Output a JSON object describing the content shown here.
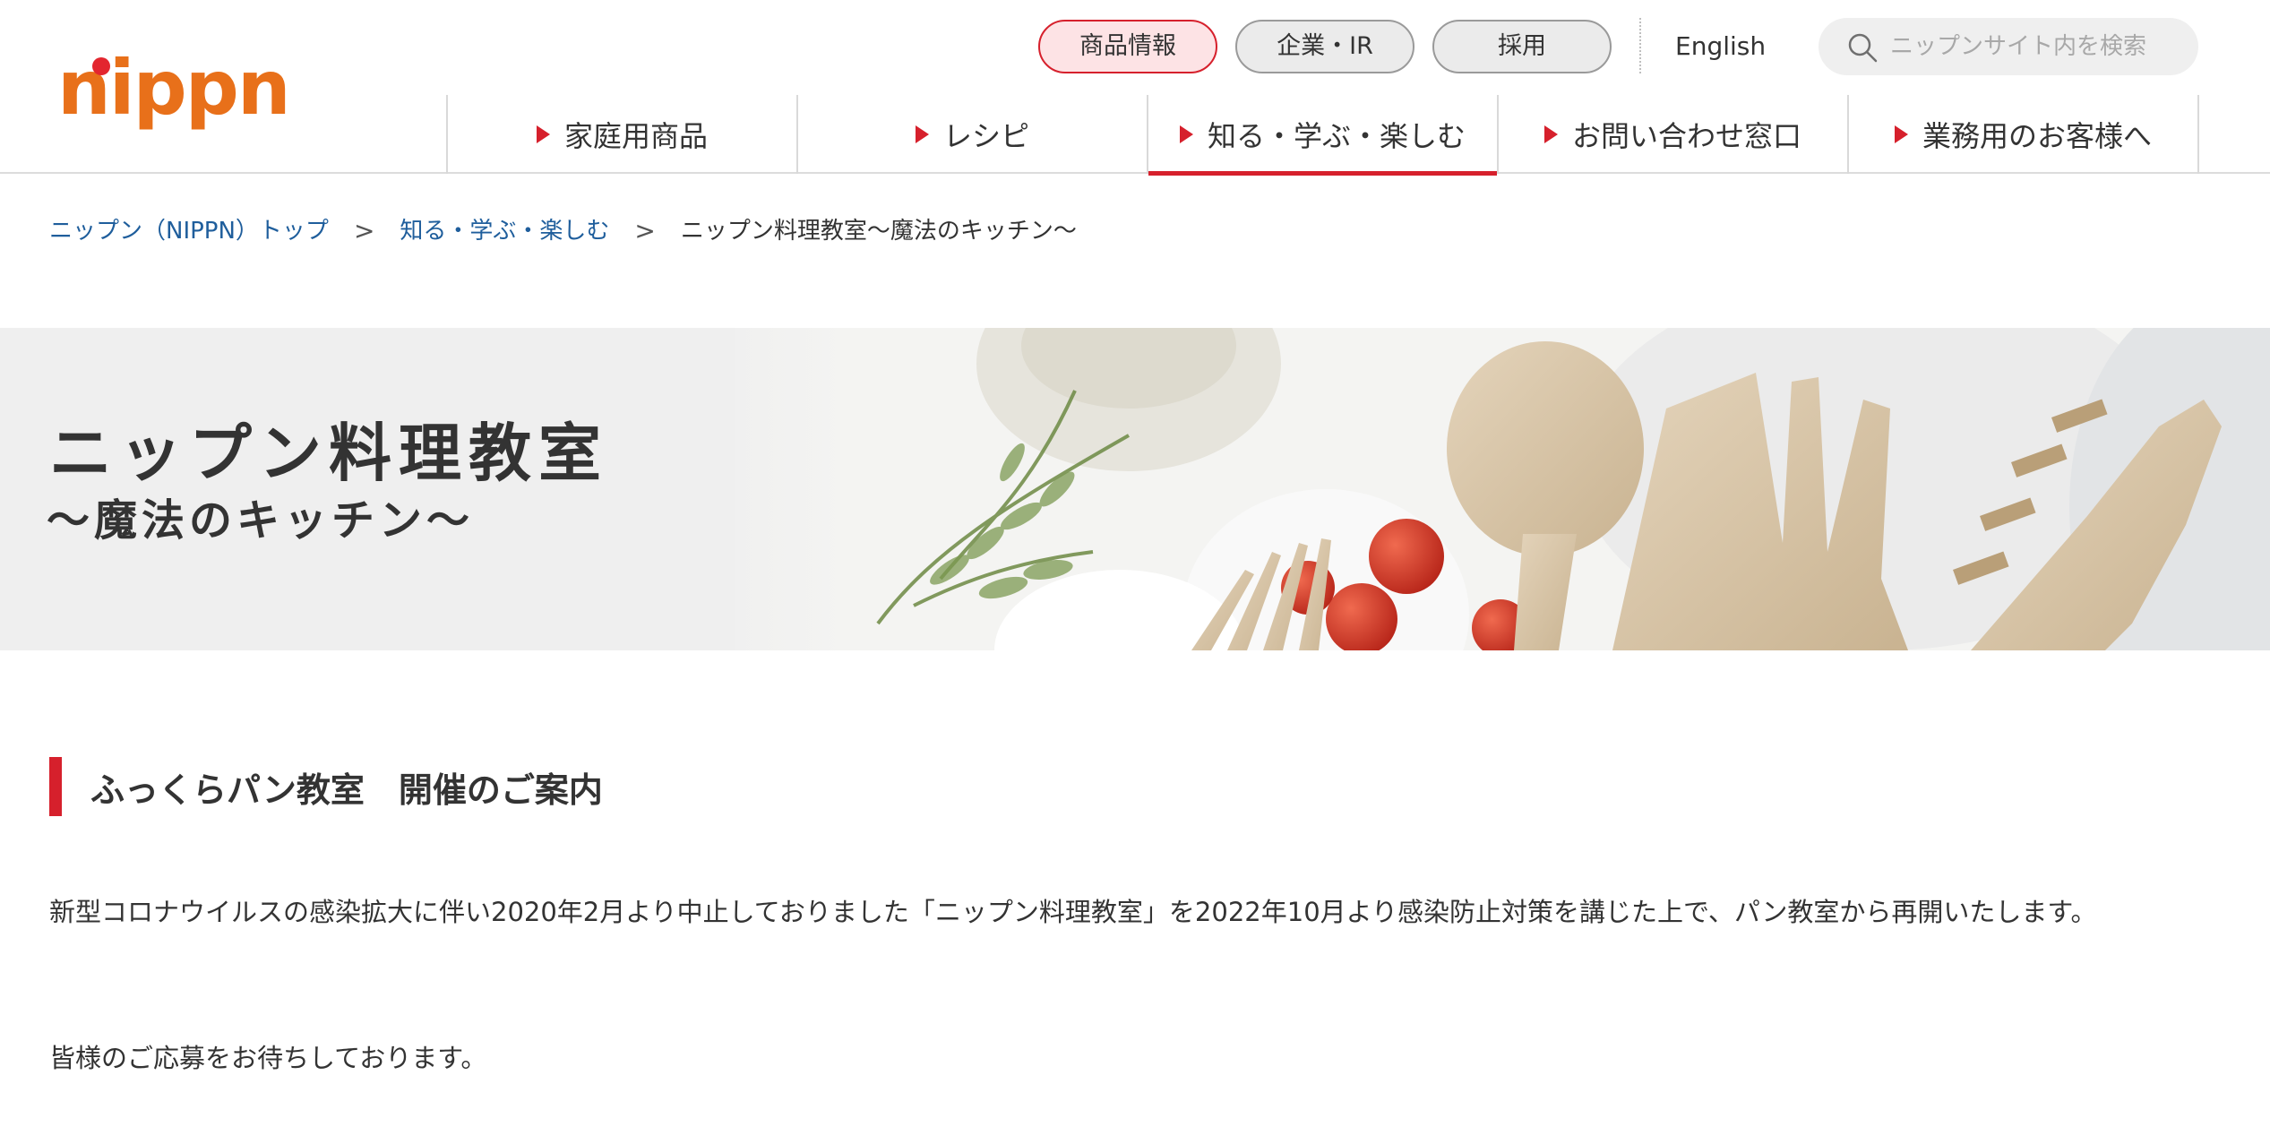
{
  "header": {
    "logo_text": "nippn",
    "util_nav": [
      "商品情報",
      "企業・IR",
      "採用"
    ],
    "english": "English",
    "search_placeholder": "ニップンサイト内を検索",
    "global_nav": [
      "家庭用商品",
      "レシピ",
      "知る・学ぶ・楽しむ",
      "お問い合わせ窓口",
      "業務用のお客様へ"
    ],
    "active_util": "商品情報",
    "active_global": "知る・学ぶ・楽しむ"
  },
  "breadcrumb": {
    "items": [
      "ニップン（NIPPN）トップ",
      "知る・学ぶ・楽しむ"
    ],
    "separator": ">",
    "current": "ニップン料理教室〜魔法のキッチン〜"
  },
  "hero": {
    "title": "ニップン料理教室",
    "subtitle": "〜魔法のキッチン〜"
  },
  "content": {
    "heading": "ふっくらパン教室　開催のご案内",
    "paragraph1": "新型コロナウイルスの感染拡大に伴い2020年2月より中止しておりました「ニップン料理教室」を2022年10月より感染防止対策を講じた上で、パン教室から再開いたします。",
    "paragraph2": "皆様のご応募をお待ちしております。"
  },
  "colors": {
    "accent_red": "#d6202c",
    "logo_orange": "#e8701a",
    "link_blue": "#1f5e9c",
    "hero_bg": "#efefef"
  },
  "icons": {
    "search": "search-icon",
    "nav_arrow": "triangle-right-icon"
  }
}
